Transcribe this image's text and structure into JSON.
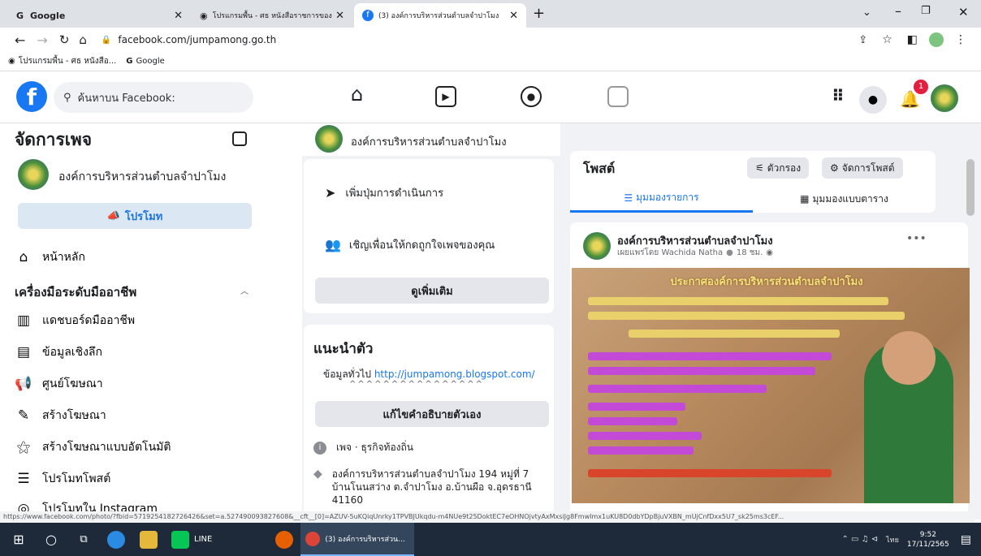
{
  "browser": {
    "tabs": [
      {
        "label": "Google",
        "icon": "G"
      },
      {
        "label": "โปรแกรมพื้น - ศธ หนังสือราชการของ",
        "icon": "globe"
      },
      {
        "label": "(3) องค์การบริหารส่วนตำบลจำปาโมง",
        "icon": "facebook"
      }
    ],
    "new_tab": "+",
    "url": "facebook.com/jumpamong.go.th",
    "bookmarks": [
      "โปรแกรมพื้น - ศธ หนังสือ...",
      "Google"
    ],
    "status_url": "https://www.facebook.com/photo/?fbid=5719254182726426&set=a.527490093827608&__cft__[0]=AZUV-5uKQiqUnrky1TPVBJUkqdu-m4NUe9t25DoktEC7eOHNOjvtyAxMxsiJg8FmwImx1uKU8D0dbYDpBjuVXBN_mUjCnfDxx5U7_sk25ms3cEF..."
  },
  "fb": {
    "search_placeholder": "ค้นหาบน Facebook:",
    "notification_count": "1",
    "page_name": "องค์การบริหารส่วนตำบลจำปาโมง"
  },
  "left": {
    "title": "จัดการเพจ",
    "page_name": "องค์การบริหารส่วนตำบลจำปาโมง",
    "promote": "โปรโมท",
    "home": "หน้าหลัก",
    "section_title": "เครื่องมือระดับมืออาชีพ",
    "items": [
      {
        "label": "แดชบอร์ดมืออาชีพ",
        "icon": "dashboard-icon"
      },
      {
        "label": "ข้อมูลเชิงลึก",
        "icon": "insights-icon"
      },
      {
        "label": "ศูนย์โฆษณา",
        "icon": "megaphone-icon"
      },
      {
        "label": "สร้างโฆษณา",
        "icon": "pencil-icon"
      },
      {
        "label": "สร้างโฆษณาแบบอัตโนมัติ",
        "icon": "magic-wand-icon"
      },
      {
        "label": "โปรโมทโพสต์",
        "icon": "promote-post-icon"
      },
      {
        "label": "โปรโมทใน Instagram",
        "icon": "instagram-icon"
      }
    ]
  },
  "middle": {
    "header_page_name": "องค์การบริหารส่วนตำบลจำปาโมง",
    "add_action": "เพิ่มปุ่มการดำเนินการ",
    "invite": "เชิญเพื่อนให้กดถูกใจเพจของคุณ",
    "see_more": "ดูเพิ่มเติม",
    "intro_title": "แนะนำตัว",
    "intro_label": "ข้อมูลทั่วไป",
    "intro_link": "http://jumpamong.blogspot.com/",
    "intro_carets": "^^^^^^^^^^^^^^^^",
    "edit_bio": "แก้ไขคำอธิบายตัวเอง",
    "category": "เพจ · ธุรกิจท้องถิ่น",
    "address": "องค์การบริหารส่วนตำบลจำปาโมง 194 หมู่ที่ 7 บ้านโนนสว่าง ต.จำปาโมง อ.บ้านผือ จ.อุดรธานี 41160"
  },
  "right": {
    "posts_title": "โพสต์",
    "filter": "ตัวกรอง",
    "manage": "จัดการโพสต์",
    "list_view": "มุมมองรายการ",
    "grid_view": "มุมมองแบบตาราง",
    "post_author": "องค์การบริหารส่วนตำบลจำปาโมง",
    "post_meta": "เผยแพร่โดย Wachida Natha",
    "post_time": "18 ชม.",
    "poster_heading": "ประกาศองค์การบริหารส่วนตำบลจำปาโมง"
  },
  "taskbar": {
    "line_label": "LINE",
    "chrome_label": "(3) องค์การบริหารส่วน...",
    "time": "9:52",
    "date": "17/11/2565",
    "lang": "ไทย"
  }
}
